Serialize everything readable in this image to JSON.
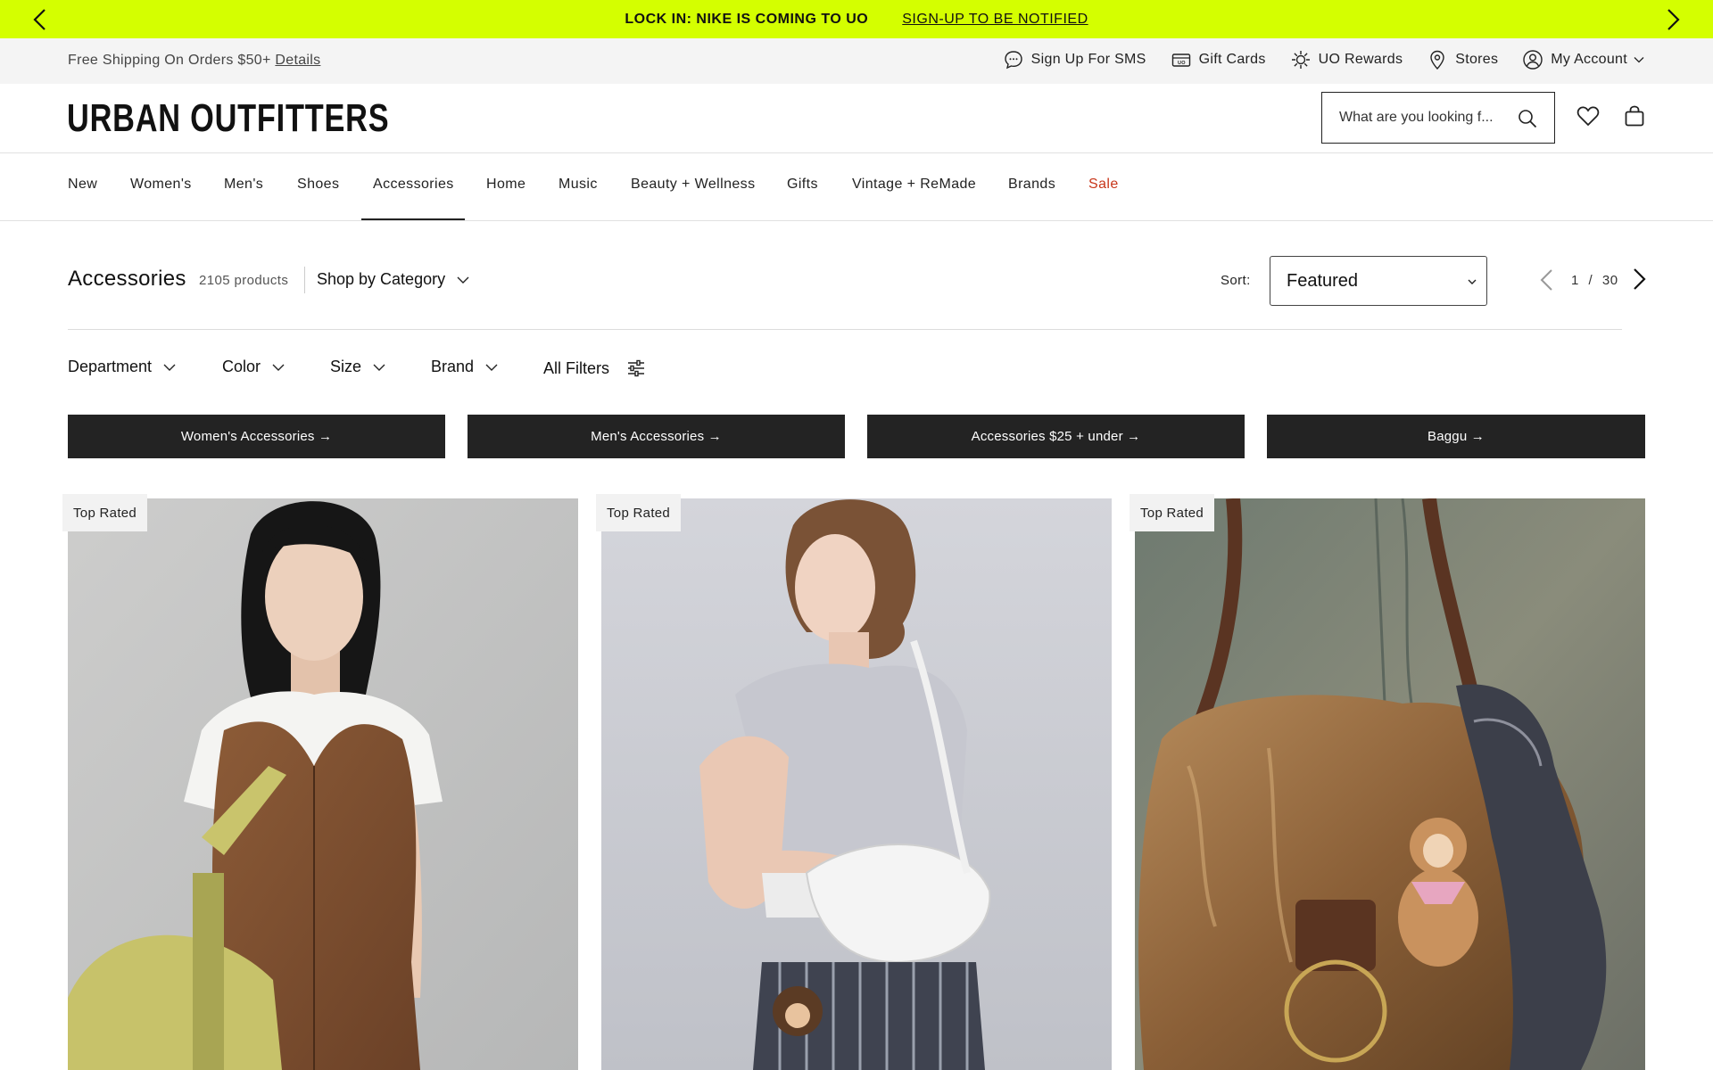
{
  "promo": {
    "text": "LOCK IN: NIKE IS COMING TO UO",
    "link": "SIGN-UP TO BE NOTIFIED"
  },
  "utility": {
    "shipping_text": "Free Shipping On Orders $50+",
    "details_link": "Details",
    "links": [
      {
        "label": "Sign Up For SMS",
        "icon": "chat-bubble-icon"
      },
      {
        "label": "Gift Cards",
        "icon": "gift-card-icon"
      },
      {
        "label": "UO Rewards",
        "icon": "rewards-sun-icon"
      },
      {
        "label": "Stores",
        "icon": "location-pin-icon"
      },
      {
        "label": "My Account",
        "icon": "user-circle-icon"
      }
    ]
  },
  "header": {
    "logo": "URBAN OUTFITTERS",
    "search_placeholder": "What are you looking f..."
  },
  "nav": {
    "items": [
      "New",
      "Women's",
      "Men's",
      "Shoes",
      "Accessories",
      "Home",
      "Music",
      "Beauty + Wellness",
      "Gifts",
      "Vintage + ReMade",
      "Brands",
      "Sale"
    ],
    "active": "Accessories"
  },
  "listing": {
    "title": "Accessories",
    "count": "2105 products",
    "shop_by_category": "Shop by Category",
    "sort_label": "Sort:",
    "sort_value": "Featured",
    "page_current": "1",
    "page_separator": "/",
    "page_total": "30"
  },
  "filters": [
    "Department",
    "Color",
    "Size",
    "Brand",
    "All Filters"
  ],
  "category_pills": [
    "Women's Accessories →",
    "Men's Accessories →",
    "Accessories $25 + under →",
    "Baggu →"
  ],
  "products": [
    {
      "badge": "Top Rated",
      "image": "woman-in-suede-vest-with-green-crossbody-bag"
    },
    {
      "badge": "Top Rated",
      "image": "woman-with-white-quilted-shoulder-bag"
    },
    {
      "badge": "Top Rated",
      "image": "faux-fur-hobo-bag-with-plush-keychain"
    }
  ],
  "colors": {
    "promo_bg": "#d4ff00",
    "utility_bg": "#f4f4f4",
    "pill_bg": "#232323",
    "sale": "#c8361a"
  }
}
